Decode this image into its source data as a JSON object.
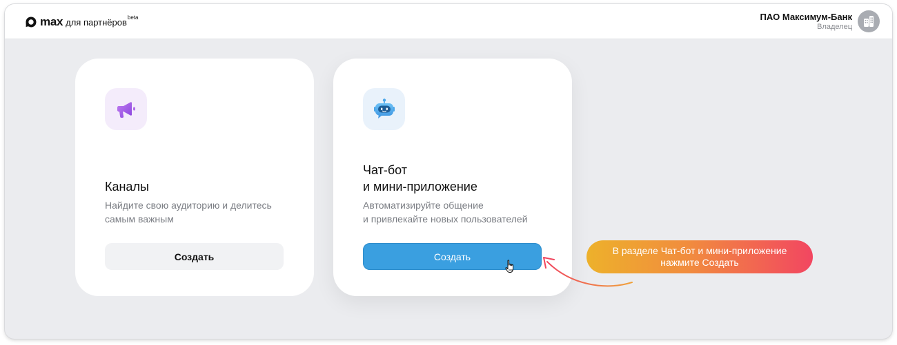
{
  "header": {
    "logo": {
      "brand": "max",
      "suffix": "для партнёров",
      "badge": "beta"
    },
    "account": {
      "name": "ПАО Максимум-Банк",
      "role": "Владелец"
    }
  },
  "cards": [
    {
      "title": "Каналы",
      "description": "Найдите свою аудиторию и делитесь\nсамым важным",
      "button": "Создать",
      "icon": "megaphone-icon"
    },
    {
      "title": "Чат-бот\nи мини-приложение",
      "description": "Автоматизируйте общение\nи привлекайте новых пользователей",
      "button": "Создать",
      "icon": "robot-icon"
    }
  ],
  "callout": {
    "text": "В разделе Чат-бот и мини-приложение\nнажмите Создать"
  },
  "colors": {
    "accent": "#3a9fe0",
    "background": "#ebecef",
    "callout_start": "#edb12b",
    "callout_end": "#f24661"
  }
}
